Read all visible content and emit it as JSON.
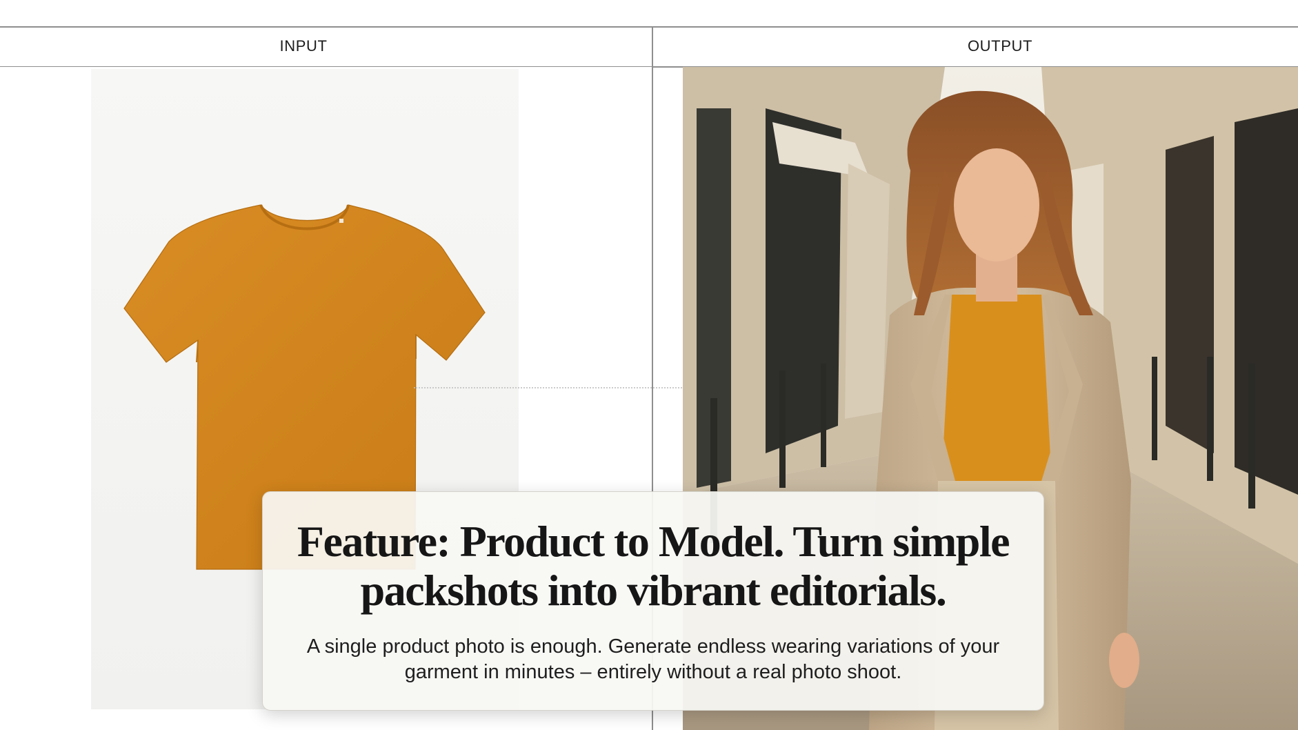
{
  "header": {
    "input_label": "INPUT",
    "output_label": "OUTPUT"
  },
  "input": {
    "garment_name": "t-shirt-icon",
    "garment_color": "#D4861F"
  },
  "output": {
    "scene_icon": "model-in-street-photo",
    "top_color": "#D98F1C",
    "coat_color": "#CDB79A"
  },
  "card": {
    "headline": "Feature: Product to Model. Turn simple packshots into vibrant editorials.",
    "subtext": "A single product photo is enough. Generate endless wearing variations of your garment in minutes – entirely without a real photo shoot."
  }
}
